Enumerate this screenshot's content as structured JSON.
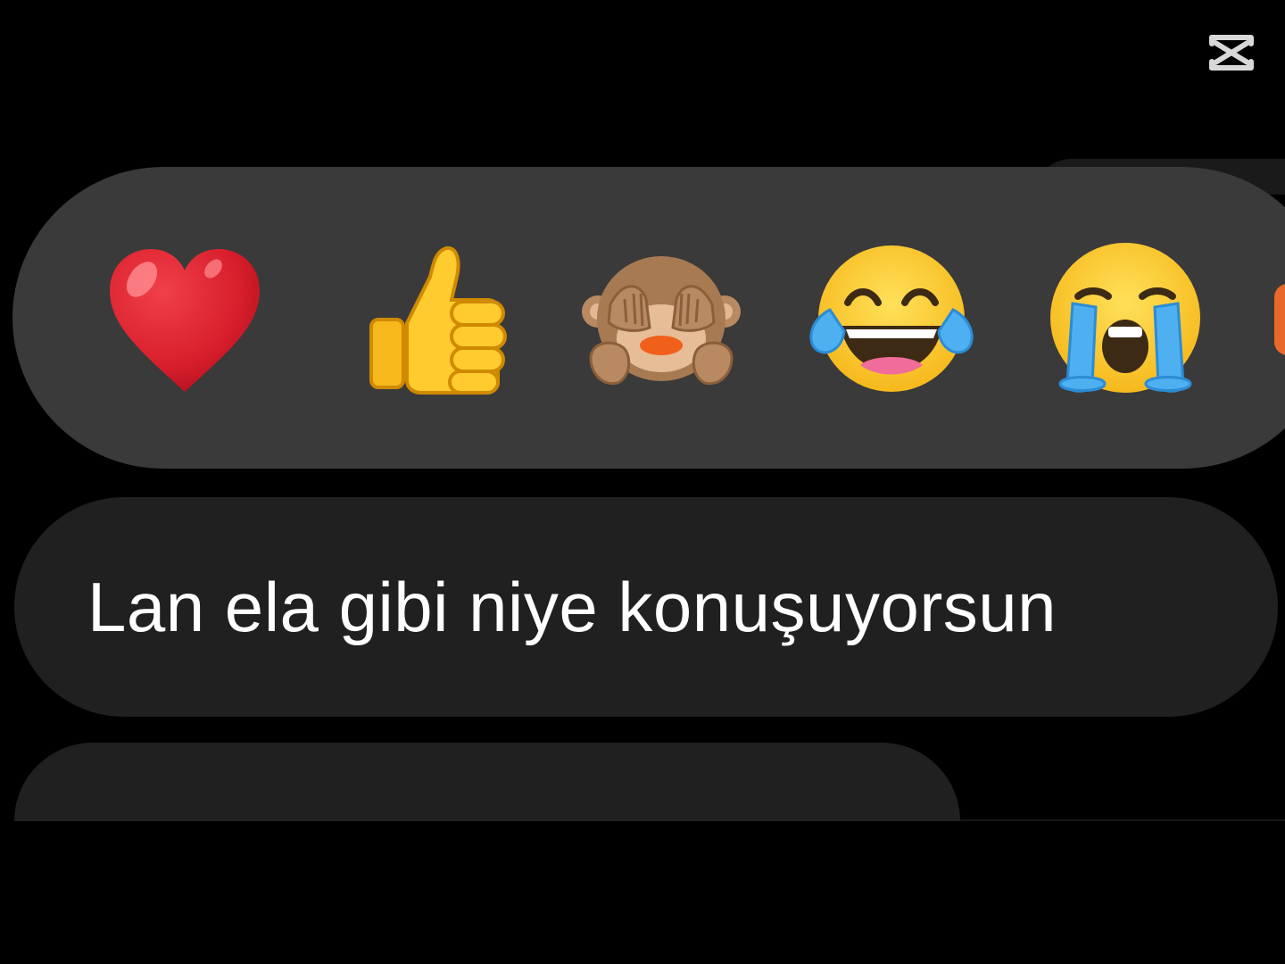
{
  "watermark": {
    "icon": "capcut-logo-icon",
    "color": "#d8d8d8"
  },
  "reaction_bar": {
    "background": "#3a3a3a",
    "reactions": [
      {
        "name": "heart",
        "emoji": "❤️",
        "icon": "red-heart-icon"
      },
      {
        "name": "thumbs-up",
        "emoji": "👍",
        "icon": "thumbs-up-icon"
      },
      {
        "name": "see-no-evil-monkey",
        "emoji": "🙈",
        "icon": "see-no-evil-monkey-icon"
      },
      {
        "name": "tears-of-joy",
        "emoji": "😂",
        "icon": "face-with-tears-of-joy-icon"
      },
      {
        "name": "loudly-crying",
        "emoji": "😭",
        "icon": "loudly-crying-face-icon"
      }
    ]
  },
  "message": {
    "text": "Lan ela gibi niye konuşuyorsun",
    "bubble_color": "#202020",
    "text_color": "#ffffff"
  }
}
